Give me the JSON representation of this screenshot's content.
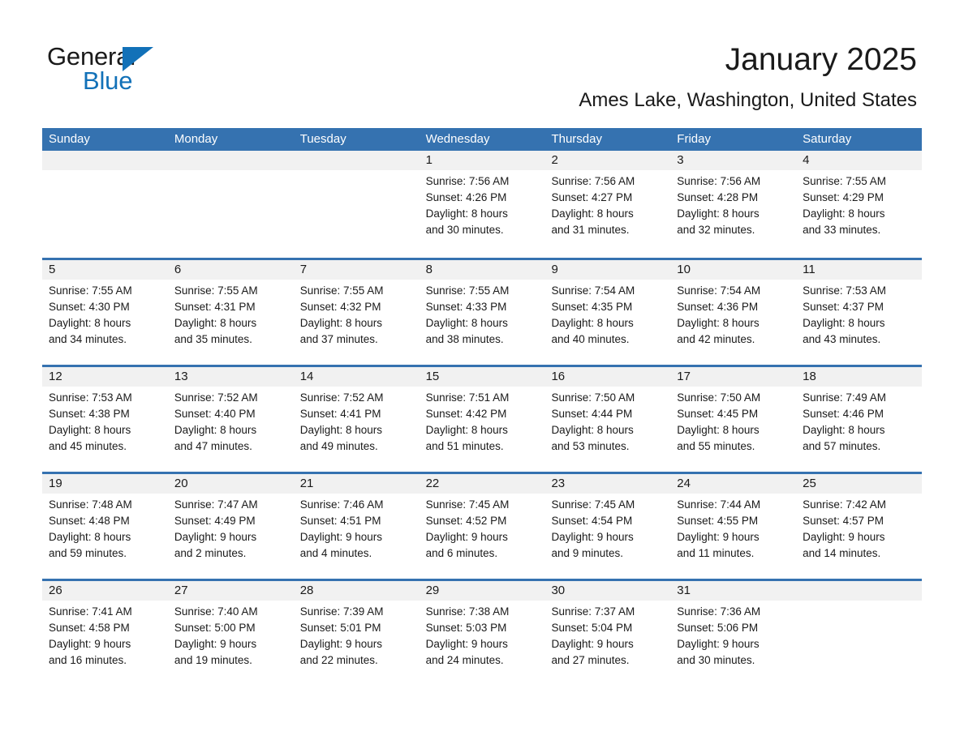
{
  "brand": {
    "name_part1": "General",
    "name_part2": "Blue",
    "triangle_color": "#1271b8"
  },
  "header": {
    "title": "January 2025",
    "location": "Ames Lake, Washington, United States",
    "accent_color": "#3572b0",
    "band_color": "#f1f1f1"
  },
  "weekdays": [
    "Sunday",
    "Monday",
    "Tuesday",
    "Wednesday",
    "Thursday",
    "Friday",
    "Saturday"
  ],
  "weeks": [
    [
      {
        "empty": true,
        "day": "",
        "sunrise": "",
        "sunset": "",
        "daylight1": "",
        "daylight2": ""
      },
      {
        "empty": true,
        "day": "",
        "sunrise": "",
        "sunset": "",
        "daylight1": "",
        "daylight2": ""
      },
      {
        "empty": true,
        "day": "",
        "sunrise": "",
        "sunset": "",
        "daylight1": "",
        "daylight2": ""
      },
      {
        "empty": false,
        "day": "1",
        "sunrise": "Sunrise: 7:56 AM",
        "sunset": "Sunset: 4:26 PM",
        "daylight1": "Daylight: 8 hours",
        "daylight2": "and 30 minutes."
      },
      {
        "empty": false,
        "day": "2",
        "sunrise": "Sunrise: 7:56 AM",
        "sunset": "Sunset: 4:27 PM",
        "daylight1": "Daylight: 8 hours",
        "daylight2": "and 31 minutes."
      },
      {
        "empty": false,
        "day": "3",
        "sunrise": "Sunrise: 7:56 AM",
        "sunset": "Sunset: 4:28 PM",
        "daylight1": "Daylight: 8 hours",
        "daylight2": "and 32 minutes."
      },
      {
        "empty": false,
        "day": "4",
        "sunrise": "Sunrise: 7:55 AM",
        "sunset": "Sunset: 4:29 PM",
        "daylight1": "Daylight: 8 hours",
        "daylight2": "and 33 minutes."
      }
    ],
    [
      {
        "empty": false,
        "day": "5",
        "sunrise": "Sunrise: 7:55 AM",
        "sunset": "Sunset: 4:30 PM",
        "daylight1": "Daylight: 8 hours",
        "daylight2": "and 34 minutes."
      },
      {
        "empty": false,
        "day": "6",
        "sunrise": "Sunrise: 7:55 AM",
        "sunset": "Sunset: 4:31 PM",
        "daylight1": "Daylight: 8 hours",
        "daylight2": "and 35 minutes."
      },
      {
        "empty": false,
        "day": "7",
        "sunrise": "Sunrise: 7:55 AM",
        "sunset": "Sunset: 4:32 PM",
        "daylight1": "Daylight: 8 hours",
        "daylight2": "and 37 minutes."
      },
      {
        "empty": false,
        "day": "8",
        "sunrise": "Sunrise: 7:55 AM",
        "sunset": "Sunset: 4:33 PM",
        "daylight1": "Daylight: 8 hours",
        "daylight2": "and 38 minutes."
      },
      {
        "empty": false,
        "day": "9",
        "sunrise": "Sunrise: 7:54 AM",
        "sunset": "Sunset: 4:35 PM",
        "daylight1": "Daylight: 8 hours",
        "daylight2": "and 40 minutes."
      },
      {
        "empty": false,
        "day": "10",
        "sunrise": "Sunrise: 7:54 AM",
        "sunset": "Sunset: 4:36 PM",
        "daylight1": "Daylight: 8 hours",
        "daylight2": "and 42 minutes."
      },
      {
        "empty": false,
        "day": "11",
        "sunrise": "Sunrise: 7:53 AM",
        "sunset": "Sunset: 4:37 PM",
        "daylight1": "Daylight: 8 hours",
        "daylight2": "and 43 minutes."
      }
    ],
    [
      {
        "empty": false,
        "day": "12",
        "sunrise": "Sunrise: 7:53 AM",
        "sunset": "Sunset: 4:38 PM",
        "daylight1": "Daylight: 8 hours",
        "daylight2": "and 45 minutes."
      },
      {
        "empty": false,
        "day": "13",
        "sunrise": "Sunrise: 7:52 AM",
        "sunset": "Sunset: 4:40 PM",
        "daylight1": "Daylight: 8 hours",
        "daylight2": "and 47 minutes."
      },
      {
        "empty": false,
        "day": "14",
        "sunrise": "Sunrise: 7:52 AM",
        "sunset": "Sunset: 4:41 PM",
        "daylight1": "Daylight: 8 hours",
        "daylight2": "and 49 minutes."
      },
      {
        "empty": false,
        "day": "15",
        "sunrise": "Sunrise: 7:51 AM",
        "sunset": "Sunset: 4:42 PM",
        "daylight1": "Daylight: 8 hours",
        "daylight2": "and 51 minutes."
      },
      {
        "empty": false,
        "day": "16",
        "sunrise": "Sunrise: 7:50 AM",
        "sunset": "Sunset: 4:44 PM",
        "daylight1": "Daylight: 8 hours",
        "daylight2": "and 53 minutes."
      },
      {
        "empty": false,
        "day": "17",
        "sunrise": "Sunrise: 7:50 AM",
        "sunset": "Sunset: 4:45 PM",
        "daylight1": "Daylight: 8 hours",
        "daylight2": "and 55 minutes."
      },
      {
        "empty": false,
        "day": "18",
        "sunrise": "Sunrise: 7:49 AM",
        "sunset": "Sunset: 4:46 PM",
        "daylight1": "Daylight: 8 hours",
        "daylight2": "and 57 minutes."
      }
    ],
    [
      {
        "empty": false,
        "day": "19",
        "sunrise": "Sunrise: 7:48 AM",
        "sunset": "Sunset: 4:48 PM",
        "daylight1": "Daylight: 8 hours",
        "daylight2": "and 59 minutes."
      },
      {
        "empty": false,
        "day": "20",
        "sunrise": "Sunrise: 7:47 AM",
        "sunset": "Sunset: 4:49 PM",
        "daylight1": "Daylight: 9 hours",
        "daylight2": "and 2 minutes."
      },
      {
        "empty": false,
        "day": "21",
        "sunrise": "Sunrise: 7:46 AM",
        "sunset": "Sunset: 4:51 PM",
        "daylight1": "Daylight: 9 hours",
        "daylight2": "and 4 minutes."
      },
      {
        "empty": false,
        "day": "22",
        "sunrise": "Sunrise: 7:45 AM",
        "sunset": "Sunset: 4:52 PM",
        "daylight1": "Daylight: 9 hours",
        "daylight2": "and 6 minutes."
      },
      {
        "empty": false,
        "day": "23",
        "sunrise": "Sunrise: 7:45 AM",
        "sunset": "Sunset: 4:54 PM",
        "daylight1": "Daylight: 9 hours",
        "daylight2": "and 9 minutes."
      },
      {
        "empty": false,
        "day": "24",
        "sunrise": "Sunrise: 7:44 AM",
        "sunset": "Sunset: 4:55 PM",
        "daylight1": "Daylight: 9 hours",
        "daylight2": "and 11 minutes."
      },
      {
        "empty": false,
        "day": "25",
        "sunrise": "Sunrise: 7:42 AM",
        "sunset": "Sunset: 4:57 PM",
        "daylight1": "Daylight: 9 hours",
        "daylight2": "and 14 minutes."
      }
    ],
    [
      {
        "empty": false,
        "day": "26",
        "sunrise": "Sunrise: 7:41 AM",
        "sunset": "Sunset: 4:58 PM",
        "daylight1": "Daylight: 9 hours",
        "daylight2": "and 16 minutes."
      },
      {
        "empty": false,
        "day": "27",
        "sunrise": "Sunrise: 7:40 AM",
        "sunset": "Sunset: 5:00 PM",
        "daylight1": "Daylight: 9 hours",
        "daylight2": "and 19 minutes."
      },
      {
        "empty": false,
        "day": "28",
        "sunrise": "Sunrise: 7:39 AM",
        "sunset": "Sunset: 5:01 PM",
        "daylight1": "Daylight: 9 hours",
        "daylight2": "and 22 minutes."
      },
      {
        "empty": false,
        "day": "29",
        "sunrise": "Sunrise: 7:38 AM",
        "sunset": "Sunset: 5:03 PM",
        "daylight1": "Daylight: 9 hours",
        "daylight2": "and 24 minutes."
      },
      {
        "empty": false,
        "day": "30",
        "sunrise": "Sunrise: 7:37 AM",
        "sunset": "Sunset: 5:04 PM",
        "daylight1": "Daylight: 9 hours",
        "daylight2": "and 27 minutes."
      },
      {
        "empty": false,
        "day": "31",
        "sunrise": "Sunrise: 7:36 AM",
        "sunset": "Sunset: 5:06 PM",
        "daylight1": "Daylight: 9 hours",
        "daylight2": "and 30 minutes."
      },
      {
        "empty": true,
        "day": "",
        "sunrise": "",
        "sunset": "",
        "daylight1": "",
        "daylight2": ""
      }
    ]
  ]
}
